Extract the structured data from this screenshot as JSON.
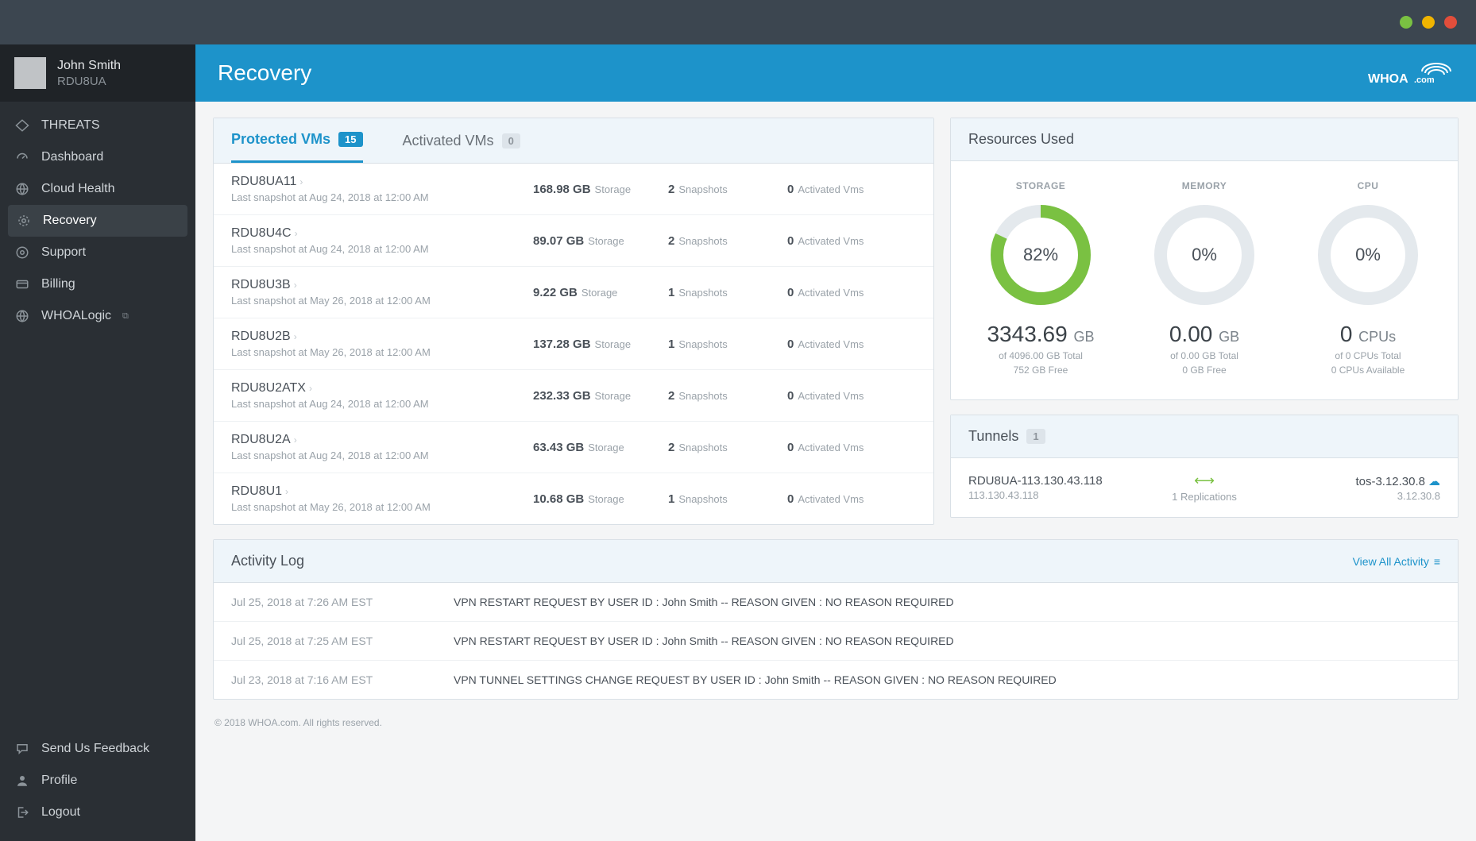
{
  "window": {
    "dots": [
      "#7ac142",
      "#f0b400",
      "#e24e3b"
    ]
  },
  "user": {
    "name": "John Smith",
    "code": "RDU8UA"
  },
  "sidebar": {
    "items": [
      {
        "label": "THREATS",
        "icon": "threats-icon"
      },
      {
        "label": "Dashboard",
        "icon": "dashboard-icon"
      },
      {
        "label": "Cloud Health",
        "icon": "cloud-health-icon"
      },
      {
        "label": "Recovery",
        "icon": "recovery-icon",
        "active": true
      },
      {
        "label": "Support",
        "icon": "support-icon"
      },
      {
        "label": "Billing",
        "icon": "billing-icon"
      },
      {
        "label": "WHOALogic",
        "icon": "whoalogic-icon",
        "external": true
      }
    ],
    "footer": [
      {
        "label": "Send Us Feedback",
        "icon": "feedback-icon"
      },
      {
        "label": "Profile",
        "icon": "profile-icon"
      },
      {
        "label": "Logout",
        "icon": "logout-icon"
      }
    ]
  },
  "header": {
    "title": "Recovery",
    "brand": "WHOA.com"
  },
  "tabs": {
    "protected": {
      "label": "Protected VMs",
      "count": "15"
    },
    "activated": {
      "label": "Activated VMs",
      "count": "0"
    }
  },
  "vms": [
    {
      "name": "RDU8UA11",
      "snap": "Last snapshot at Aug 24, 2018 at 12:00 AM",
      "storage": "168.98 GB",
      "snapshots": "2",
      "activated": "0"
    },
    {
      "name": "RDU8U4C",
      "snap": "Last snapshot at Aug 24, 2018 at 12:00 AM",
      "storage": "89.07 GB",
      "snapshots": "2",
      "activated": "0"
    },
    {
      "name": "RDU8U3B",
      "snap": "Last snapshot at May 26, 2018 at 12:00 AM",
      "storage": "9.22 GB",
      "snapshots": "1",
      "activated": "0"
    },
    {
      "name": "RDU8U2B",
      "snap": "Last snapshot at May 26, 2018 at 12:00 AM",
      "storage": "137.28 GB",
      "snapshots": "1",
      "activated": "0"
    },
    {
      "name": "RDU8U2ATX",
      "snap": "Last snapshot at Aug 24, 2018 at 12:00 AM",
      "storage": "232.33 GB",
      "snapshots": "2",
      "activated": "0"
    },
    {
      "name": "RDU8U2A",
      "snap": "Last snapshot at Aug 24, 2018 at 12:00 AM",
      "storage": "63.43 GB",
      "snapshots": "2",
      "activated": "0"
    },
    {
      "name": "RDU8U1",
      "snap": "Last snapshot at May 26, 2018 at 12:00 AM",
      "storage": "10.68 GB",
      "snapshots": "1",
      "activated": "0"
    }
  ],
  "labels": {
    "storage": "Storage",
    "snapshots": "Snapshots",
    "activated": "Activated Vms"
  },
  "resources": {
    "title": "Resources Used",
    "storage": {
      "label": "STORAGE",
      "pct": "82%",
      "pctNum": 82,
      "value": "3343.69",
      "unit": "GB",
      "total": "of 4096.00 GB Total",
      "free": "752 GB Free",
      "color": "#7ac142"
    },
    "memory": {
      "label": "MEMORY",
      "pct": "0%",
      "pctNum": 0,
      "value": "0.00",
      "unit": "GB",
      "total": "of 0.00 GB Total",
      "free": "0 GB Free",
      "color": "#cfd6db"
    },
    "cpu": {
      "label": "CPU",
      "pct": "0%",
      "pctNum": 0,
      "value": "0",
      "unit": "CPUs",
      "total": "of 0 CPUs Total",
      "free": "0 CPUs Available",
      "color": "#cfd6db"
    }
  },
  "tunnels": {
    "title": "Tunnels",
    "count": "1",
    "row": {
      "leftName": "RDU8UA-113.130.43.118",
      "leftIp": "113.130.43.118",
      "replications": "1 Replications",
      "rightName": "tos-3.12.30.8",
      "rightIp": "3.12.30.8"
    }
  },
  "activity": {
    "title": "Activity Log",
    "viewAll": "View All Activity",
    "rows": [
      {
        "time": "Jul 25, 2018 at 7:26 AM EST",
        "msg": "VPN RESTART REQUEST BY USER ID : John Smith -- REASON GIVEN : NO REASON REQUIRED"
      },
      {
        "time": "Jul 25, 2018 at 7:25 AM EST",
        "msg": "VPN RESTART REQUEST BY USER ID : John Smith -- REASON GIVEN : NO REASON REQUIRED"
      },
      {
        "time": "Jul 23, 2018 at 7:16 AM EST",
        "msg": "VPN TUNNEL SETTINGS CHANGE REQUEST BY USER ID : John Smith -- REASON GIVEN : NO REASON REQUIRED"
      }
    ]
  },
  "footer": "© 2018 WHOA.com. All rights reserved."
}
